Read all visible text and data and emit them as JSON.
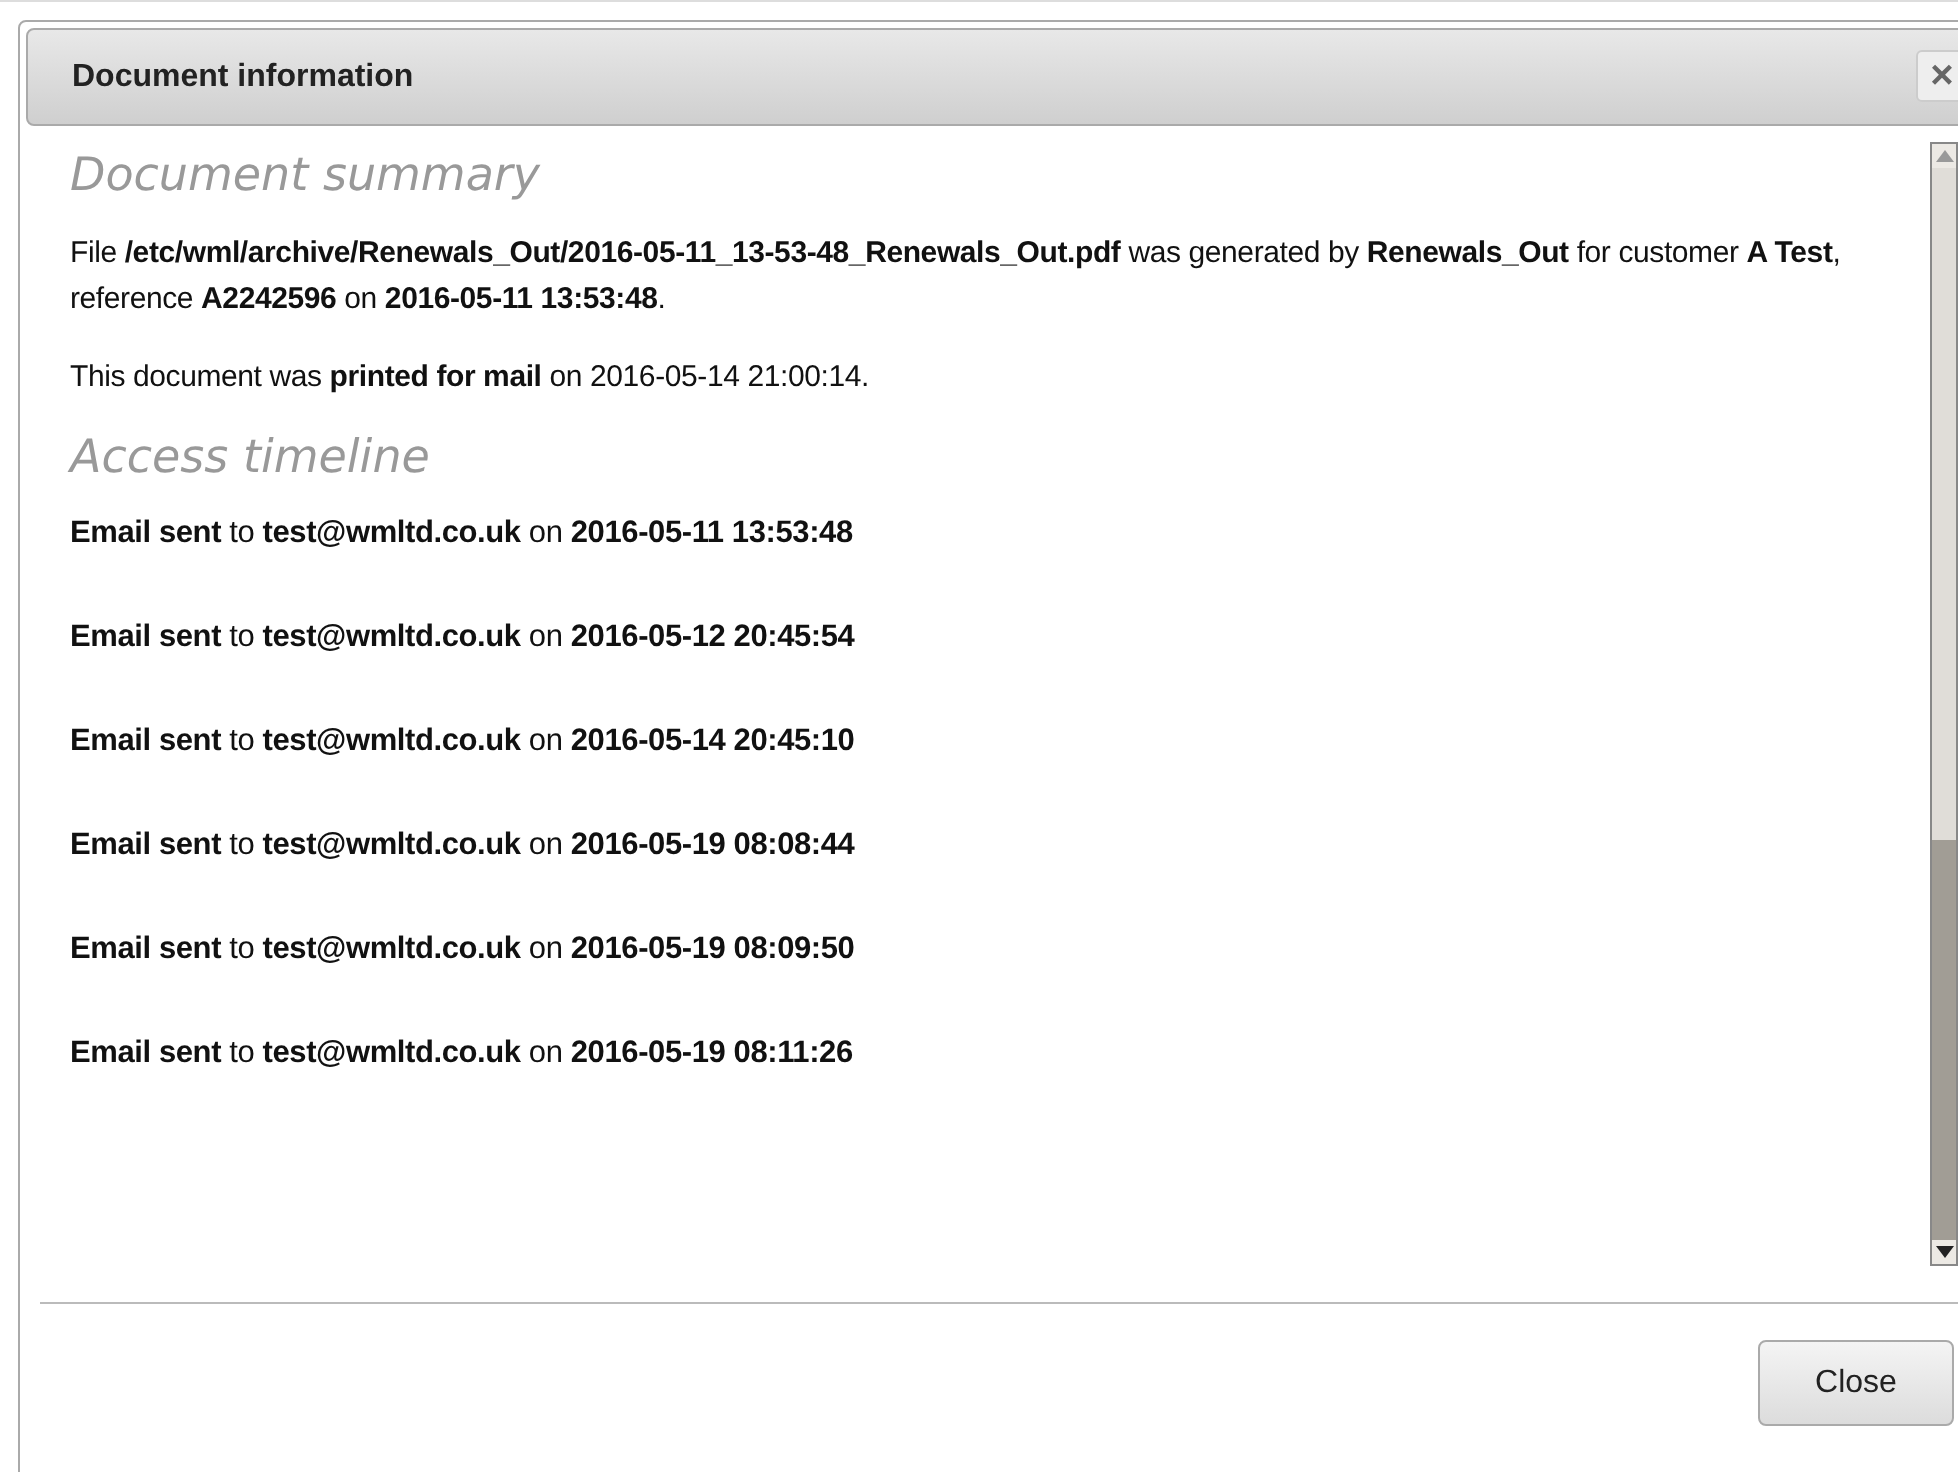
{
  "dialog": {
    "title": "Document information",
    "close_icon": "×"
  },
  "summary": {
    "heading": "Document summary",
    "paragraphs": [
      "File **/etc/wml/archive/Renewals_Out/2016-05-11_13-53-48_Renewals_Out.pdf** was generated by **Renewals_Out** for customer **A Test**, reference **A2242596** on **2016-05-11 13:53:48**.",
      "This document was **printed for mail** on 2016-05-14 21:00:14."
    ]
  },
  "timeline": {
    "heading": "Access timeline",
    "entries": [
      "**Email sent** to **test@wmltd.co.uk** on **2016-05-11 13:53:48**",
      "**Email sent** to **test@wmltd.co.uk** on **2016-05-12 20:45:54**",
      "**Email sent** to **test@wmltd.co.uk** on **2016-05-14 20:45:10**",
      "**Email sent** to **test@wmltd.co.uk** on **2016-05-19 08:08:44**",
      "**Email sent** to **test@wmltd.co.uk** on **2016-05-19 08:09:50**",
      "**Email sent** to **test@wmltd.co.uk** on **2016-05-19 08:11:26**"
    ]
  },
  "buttons": [
    "Close"
  ]
}
